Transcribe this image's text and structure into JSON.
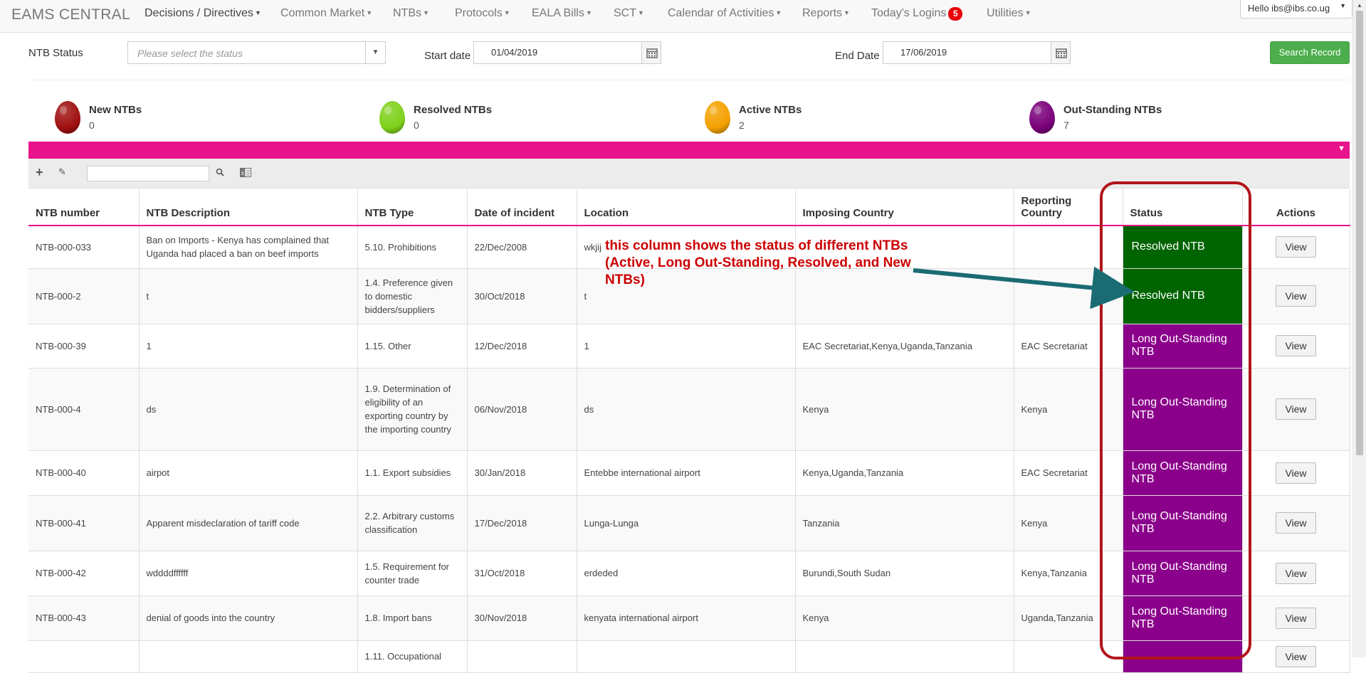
{
  "nav": {
    "brand": "EAMS CENTRAL",
    "items": [
      {
        "label": "Decisions / Directives"
      },
      {
        "label": "Common Market"
      },
      {
        "label": "NTBs"
      },
      {
        "label": "Protocols"
      },
      {
        "label": "EALA Bills"
      },
      {
        "label": "SCT"
      },
      {
        "label": "Calendar of Activities"
      },
      {
        "label": "Reports"
      },
      {
        "label": "Today's Logins",
        "badge": "5"
      },
      {
        "label": "Utilities"
      }
    ],
    "user": "Hello ibs@ibs.co.ug"
  },
  "filters": {
    "status_label": "NTB Status",
    "status_placeholder": "Please select the status",
    "start_label": "Start date",
    "start_value": "01/04/2019",
    "end_label": "End Date",
    "end_value": "17/06/2019",
    "search_button": "Search Record"
  },
  "legend": [
    {
      "title": "New NTBs",
      "count": "0",
      "color": "#a01010"
    },
    {
      "title": "Resolved NTBs",
      "count": "0",
      "color": "#7fd11b"
    },
    {
      "title": "Active NTBs",
      "count": "2",
      "color": "#f5a100"
    },
    {
      "title": "Out-Standing NTBs",
      "count": "7",
      "color": "#7a007a"
    }
  ],
  "table": {
    "headers": [
      "NTB number",
      "NTB Description",
      "NTB Type",
      "Date of incident",
      "Location",
      "Imposing Country",
      "Reporting Country",
      "Status",
      "Actions"
    ],
    "rows": [
      {
        "number": "NTB-000-033",
        "desc": "Ban on Imports - Kenya has complained that Uganda had placed a ban on beef imports",
        "type": "5.10. Prohibitions",
        "date": "22/Dec/2008",
        "location": "wkjij",
        "imposing": "",
        "reporting": "",
        "status": "Resolved NTB",
        "kind": "resolved",
        "action": "View"
      },
      {
        "number": "NTB-000-2",
        "desc": "t",
        "type": "1.4. Preference given to domestic bidders/suppliers",
        "date": "30/Oct/2018",
        "location": "t",
        "imposing": "",
        "reporting": "",
        "status": "Resolved NTB",
        "kind": "resolved",
        "action": "View"
      },
      {
        "number": "NTB-000-39",
        "desc": "1",
        "type": "1.15. Other",
        "date": "12/Dec/2018",
        "location": "1",
        "imposing": "EAC Secretariat,Kenya,Uganda,Tanzania",
        "reporting": "EAC Secretariat",
        "status": "Long Out-Standing NTB",
        "kind": "outstanding",
        "action": "View"
      },
      {
        "number": "NTB-000-4",
        "desc": "ds",
        "type": "1.9. Determination of eligibility of an exporting country by the importing country",
        "date": "06/Nov/2018",
        "location": "ds",
        "imposing": "Kenya",
        "reporting": "Kenya",
        "status": "Long Out-Standing NTB",
        "kind": "outstanding",
        "action": "View"
      },
      {
        "number": "NTB-000-40",
        "desc": "airpot",
        "type": "1.1. Export subsidies",
        "date": "30/Jan/2018",
        "location": "Entebbe international airport",
        "imposing": "Kenya,Uganda,Tanzania",
        "reporting": "EAC Secretariat",
        "status": "Long Out-Standing NTB",
        "kind": "outstanding",
        "action": "View"
      },
      {
        "number": "NTB-000-41",
        "desc": "Apparent misdeclaration of tariff code",
        "type": "2.2. Arbitrary customs classification",
        "date": "17/Dec/2018",
        "location": "Lunga-Lunga",
        "imposing": "Tanzania",
        "reporting": "Kenya",
        "status": "Long Out-Standing NTB",
        "kind": "outstanding",
        "action": "View"
      },
      {
        "number": "NTB-000-42",
        "desc": "wddddffffff",
        "type": "1.5. Requirement for counter trade",
        "date": "31/Oct/2018",
        "location": "erdeded",
        "imposing": "Burundi,South Sudan",
        "reporting": "Kenya,Tanzania",
        "status": "Long Out-Standing NTB",
        "kind": "outstanding",
        "action": "View"
      },
      {
        "number": "NTB-000-43",
        "desc": "denial of goods into the country",
        "type": "1.8. Import bans",
        "date": "30/Nov/2018",
        "location": "kenyata international airport",
        "imposing": "Kenya",
        "reporting": "Uganda,Tanzania",
        "status": "Long Out-Standing NTB",
        "kind": "outstanding",
        "action": "View"
      },
      {
        "number": "",
        "desc": "",
        "type": "1.11. Occupational",
        "date": "",
        "location": "",
        "imposing": "",
        "reporting": "",
        "status": "",
        "kind": "outstanding",
        "action": "View"
      }
    ]
  },
  "annotation": {
    "line1": "this column shows the status of different NTBs",
    "line2": "(Active, Long Out-Standing, Resolved, and New NTBs)"
  },
  "colors": {
    "resolved": "#006400",
    "outstanding": "#8b008b",
    "accent": "#e8138a",
    "highlight": "#b2151b",
    "arrow": "#1b6b73"
  }
}
